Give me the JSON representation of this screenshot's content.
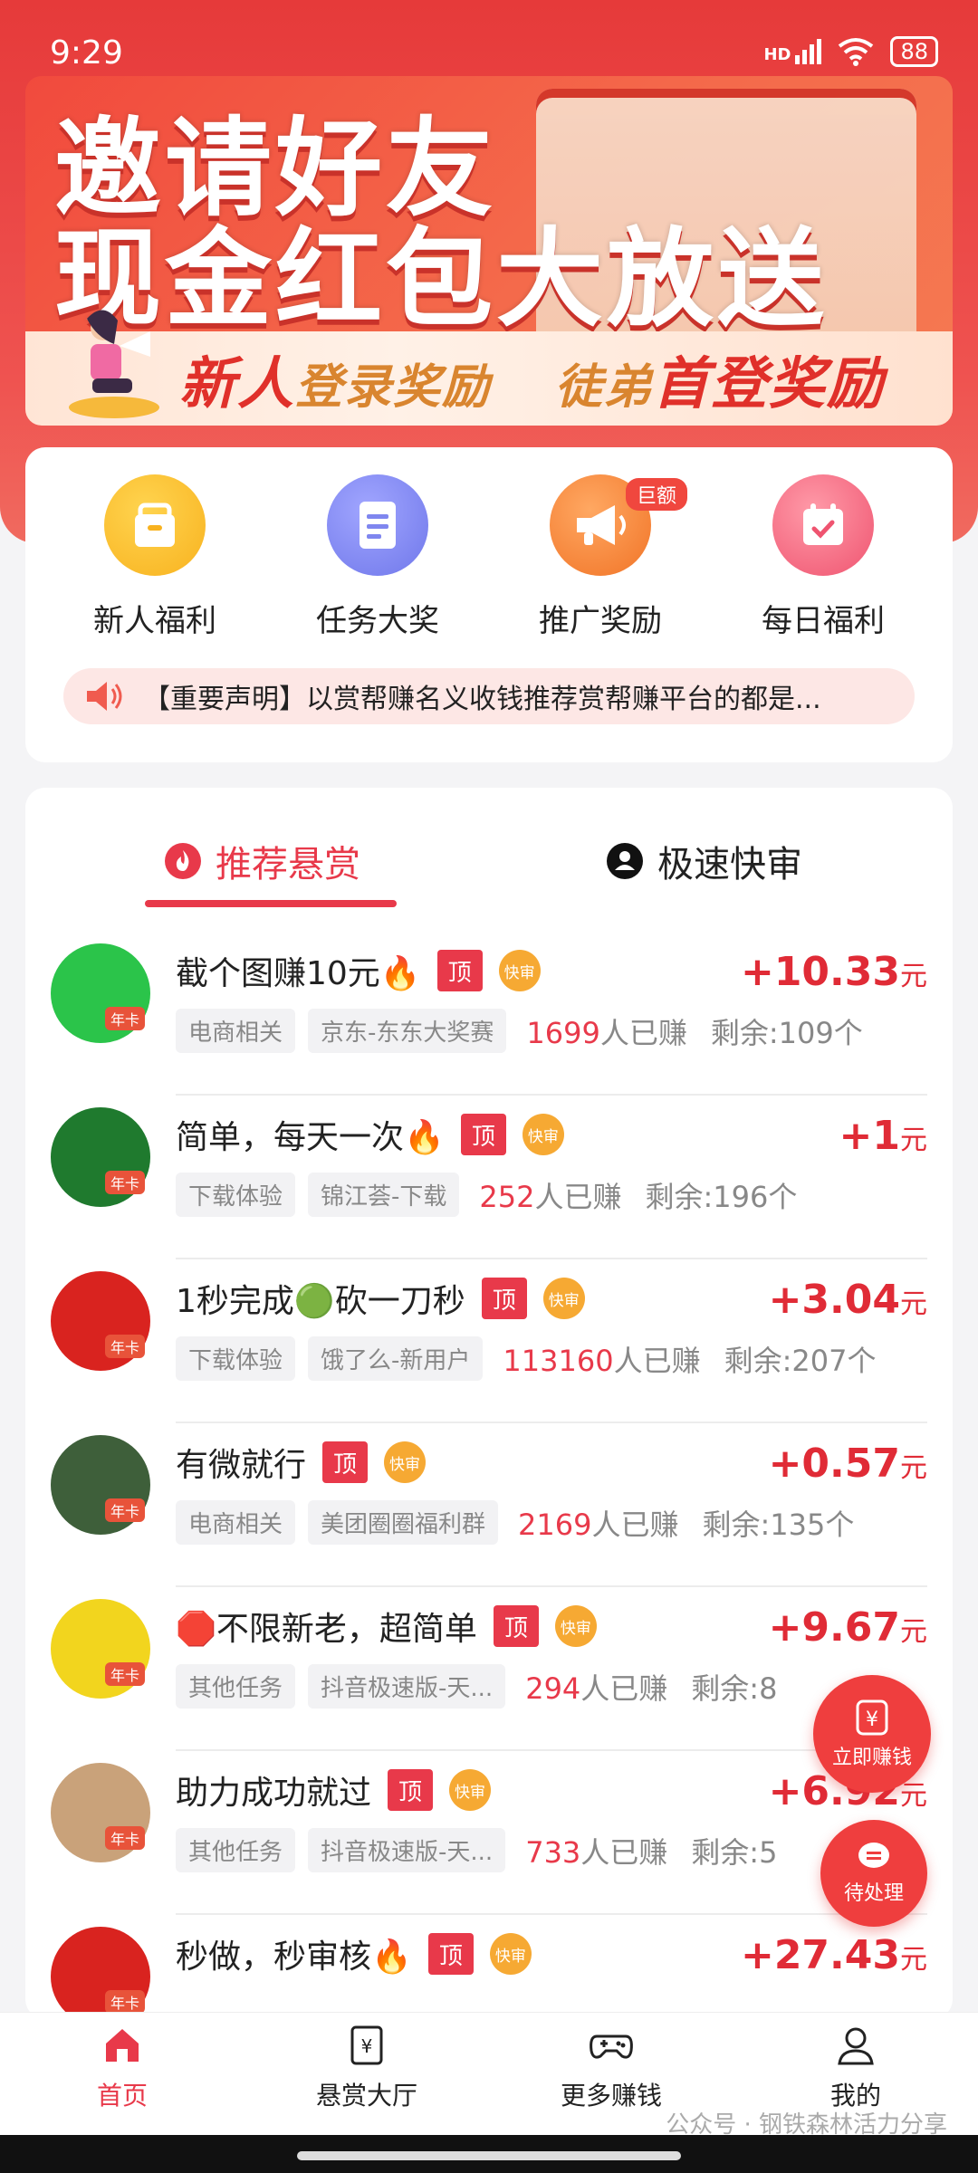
{
  "status": {
    "time": "9:29",
    "network": "HD",
    "battery": "88"
  },
  "banner": {
    "line1": "邀请好友",
    "line2": "现金红包大放送",
    "strip_a_big": "新人",
    "strip_a_small": "登录奖励",
    "strip_b_small": "徒弟",
    "strip_b_big": "首登奖励"
  },
  "quick": [
    {
      "label": "新人福利",
      "icon": "gift-bag-icon",
      "color": "#f8b21f"
    },
    {
      "label": "任务大奖",
      "icon": "document-icon",
      "color": "#7f86ef"
    },
    {
      "label": "推广奖励",
      "icon": "megaphone-icon",
      "color": "#f58233",
      "badge": "巨额"
    },
    {
      "label": "每日福利",
      "icon": "calendar-check-icon",
      "color": "#f3677b"
    }
  ],
  "notice": {
    "text": "【重要声明】以赏帮赚名义收钱推荐赏帮赚平台的都是..."
  },
  "tabs": {
    "active": "推荐悬赏",
    "other": "极速快审"
  },
  "common": {
    "top_tag": "顶",
    "fast_tag": "快审",
    "year_card": "年卡",
    "done_suffix": "人已赚",
    "unit": "元"
  },
  "tasks": [
    {
      "title": "截个图赚10元🔥",
      "cat": "电商相关",
      "platform": "京东-东东大奖赛",
      "done": "1699",
      "remain": "剩余:109个",
      "price": "+10.33",
      "avatar_color": "#2bc44a"
    },
    {
      "title": "简单，每天一次🔥",
      "cat": "下载体验",
      "platform": "锦江荟-下载",
      "done": "252",
      "remain": "剩余:196个",
      "price": "+1",
      "avatar_color": "#1f7a2e"
    },
    {
      "title": "1秒完成🟢砍一刀秒",
      "cat": "下载体验",
      "platform": "饿了么-新用户",
      "done": "113160",
      "remain": "剩余:207个",
      "price": "+3.04",
      "avatar_color": "#d9231f"
    },
    {
      "title": "有微就行",
      "cat": "电商相关",
      "platform": "美团圈圈福利群",
      "done": "2169",
      "remain": "剩余:135个",
      "price": "+0.57",
      "avatar_color": "#3e5f3a"
    },
    {
      "title": "🛑不限新老，超简单",
      "cat": "其他任务",
      "platform": "抖音极速版-天...",
      "done": "294",
      "remain": "剩余:8",
      "price": "+9.67",
      "avatar_color": "#f2d51e"
    },
    {
      "title": "助力成功就过",
      "cat": "其他任务",
      "platform": "抖音极速版-天...",
      "done": "733",
      "remain": "剩余:5",
      "price": "+6.92",
      "avatar_color": "#c9a27a"
    },
    {
      "title": "秒做，秒审核🔥",
      "cat": "",
      "platform": "",
      "done": "",
      "remain": "",
      "price": "+27.43",
      "avatar_color": "#d9231f"
    }
  ],
  "float": {
    "earn": "立即赚钱",
    "pending": "待处理"
  },
  "nav": [
    {
      "label": "首页",
      "icon": "home-icon"
    },
    {
      "label": "悬赏大厅",
      "icon": "reward-hall-icon"
    },
    {
      "label": "更多赚钱",
      "icon": "gamepad-icon"
    },
    {
      "label": "我的",
      "icon": "user-icon"
    }
  ],
  "watermark": "公众号 · 钢铁森林活力分享"
}
